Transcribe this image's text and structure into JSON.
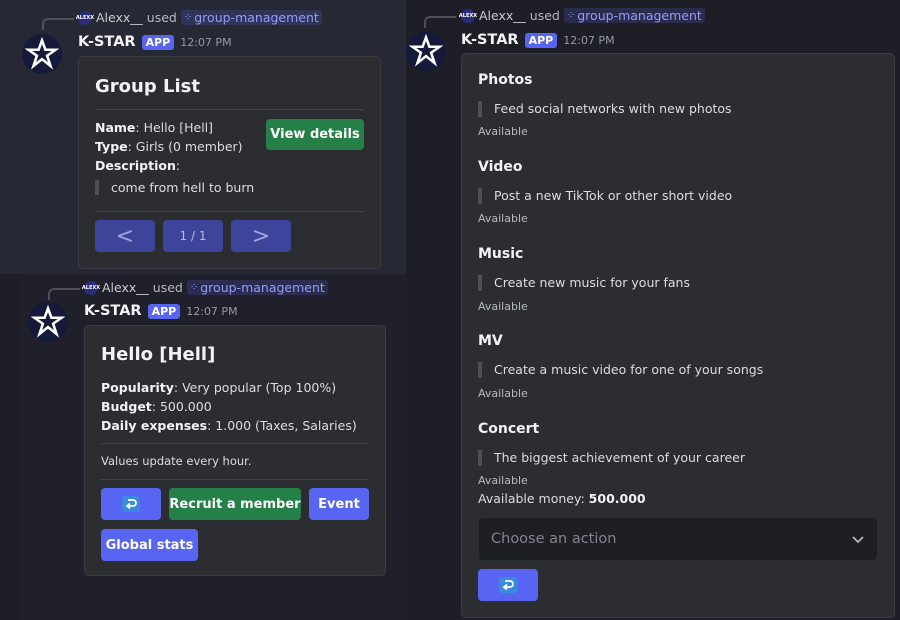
{
  "reply": {
    "user": "Alexx__",
    "action": "used",
    "command": "group-management",
    "avatar_text": "ALEXX"
  },
  "bot": {
    "name": "K-STAR",
    "tag": "APP",
    "time": "12:07 PM"
  },
  "group_list": {
    "title": "Group List",
    "name_label": "Name",
    "name_value": ": Hello [Hell]",
    "type_label": "Type",
    "type_value": ": Girls (0 member)",
    "desc_label": "Description",
    "desc_colon": ":",
    "desc_quote": "come from hell to burn",
    "view_button": "View details",
    "prev_label": "<",
    "page": "1 / 1",
    "next_label": ">"
  },
  "group_detail": {
    "title": "Hello [Hell]",
    "popularity_label": "Popularity",
    "popularity_value": ": Very popular (Top 100%)",
    "budget_label": "Budget",
    "budget_value": ": 500.000",
    "expenses_label": "Daily expenses",
    "expenses_value": ": 1.000 (Taxes, Salaries)",
    "footer": "Values update every hour.",
    "recruit_button": "Recruit a member",
    "event_button": "Event",
    "stats_button": "Global stats"
  },
  "activities": {
    "sections": [
      {
        "title": "Photos",
        "desc": "Feed social networks with new photos",
        "status": "Available"
      },
      {
        "title": "Video",
        "desc": "Post a new TikTok or other short video",
        "status": "Available"
      },
      {
        "title": "Music",
        "desc": "Create new music for your fans",
        "status": "Available"
      },
      {
        "title": "MV",
        "desc": "Create a music video for one of your songs",
        "status": "Available"
      },
      {
        "title": "Concert",
        "desc": "The biggest achievement of your career",
        "status": "Available"
      }
    ],
    "money_label": "Available money: ",
    "money_value": "500.000",
    "select_placeholder": "Choose an action"
  },
  "colors": {
    "blurple": "#5865f2",
    "green": "#248046",
    "background": "#1e1f26"
  },
  "icons": {
    "back": "return-arrow-icon",
    "dropdown": "chevron-down-icon",
    "avatar": "star-logo-icon"
  }
}
